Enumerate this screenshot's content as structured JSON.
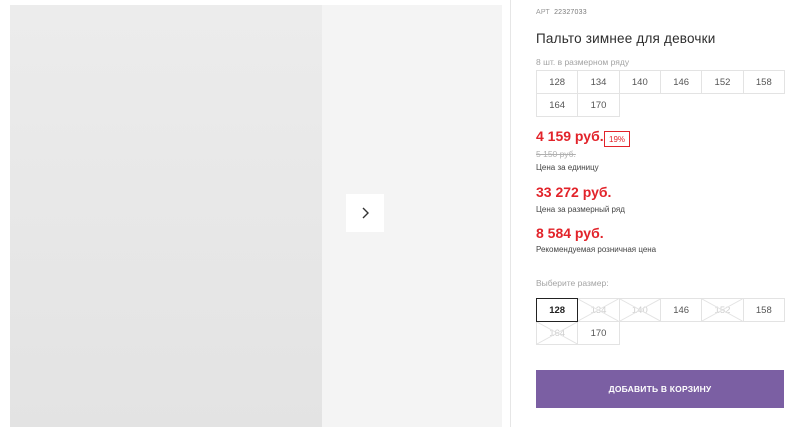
{
  "gallery": {
    "photo_alt": "",
    "next_icon": "chevron-right-icon"
  },
  "product": {
    "art_label": "АРТ",
    "art_value": "22327033",
    "title": "Пальто зимнее для девочки"
  },
  "pack": {
    "note": "8 шт. в размерном ряду",
    "sizes": [
      "128",
      "134",
      "140",
      "146",
      "152",
      "158",
      "164",
      "170"
    ]
  },
  "prices": {
    "unit_price": "4 159 руб.",
    "discount": "19%",
    "old_price": "5 150 руб.",
    "unit_label": "Цена за единицу",
    "row_price": "33 272 руб.",
    "row_label": "Цена за размерный ряд",
    "retail_price": "8 584 руб.",
    "retail_label": "Рекомендуемая розничная цена"
  },
  "size_picker": {
    "label": "Выберите размер:",
    "selected": "128",
    "options": [
      {
        "value": "128",
        "state": "selected"
      },
      {
        "value": "134",
        "state": "disabled"
      },
      {
        "value": "140",
        "state": "disabled"
      },
      {
        "value": "146",
        "state": "available"
      },
      {
        "value": "152",
        "state": "disabled"
      },
      {
        "value": "158",
        "state": "available"
      },
      {
        "value": "164",
        "state": "disabled"
      },
      {
        "value": "170",
        "state": "available"
      }
    ]
  },
  "cart": {
    "button_label": "ДОБАВИТЬ В КОРЗИНУ"
  },
  "colors": {
    "accent_price": "#e2232a",
    "cart_button": "#7b5fa3",
    "jacket": "#1c2535"
  }
}
